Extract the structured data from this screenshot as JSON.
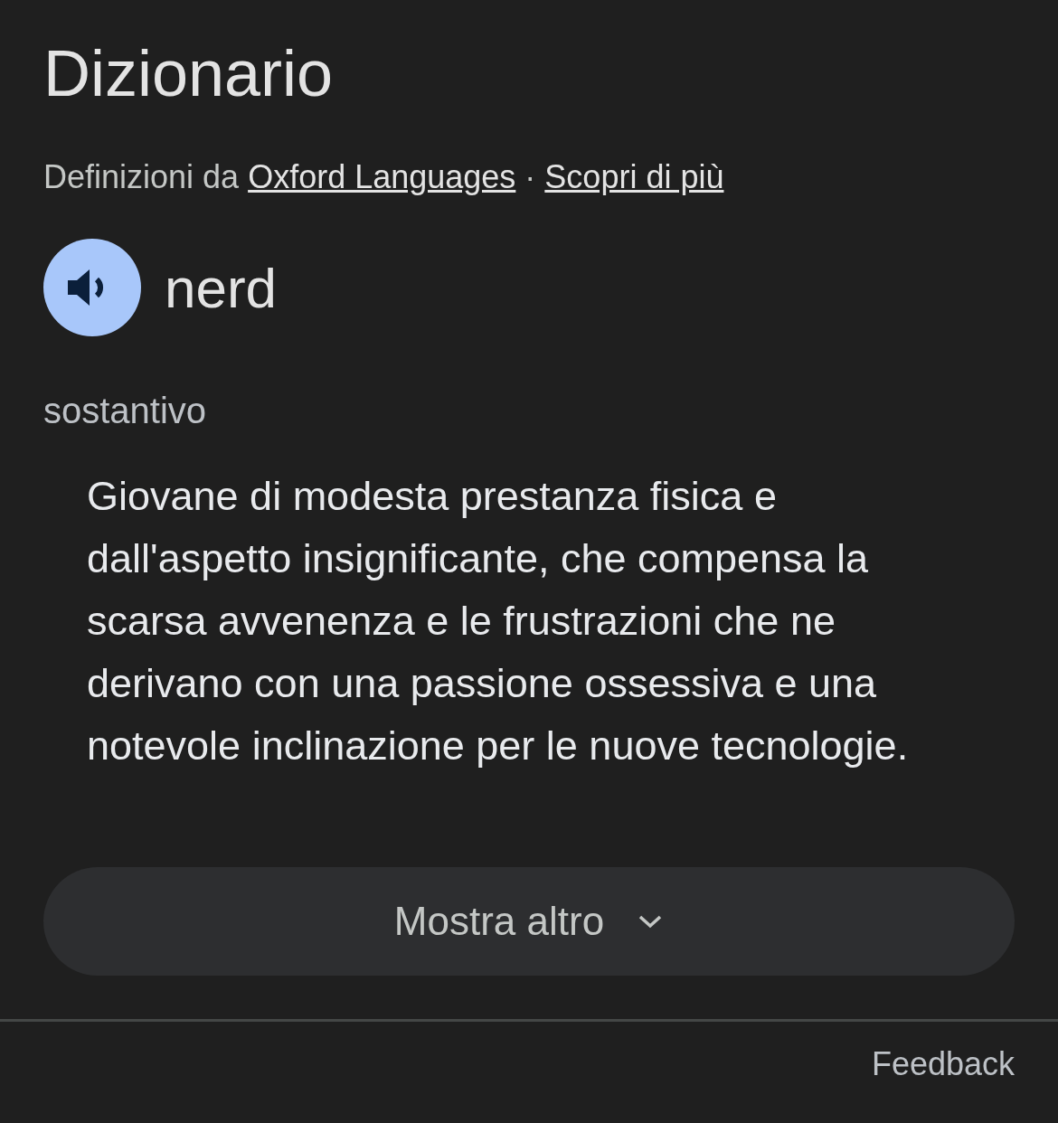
{
  "title": "Dizionario",
  "attribution": {
    "prefix": "Definizioni da",
    "source_link": "Oxford Languages",
    "separator": "·",
    "more_link": "Scopri di più"
  },
  "entry": {
    "word": "nerd",
    "part_of_speech": "sostantivo",
    "definition": "Giovane di modesta prestanza fisica e dall'aspetto insignificante, che compensa la scarsa avvenenza e le frustrazioni che ne derivano con una passione ossessiva e una notevole inclinazione per le nuove tecnologie."
  },
  "show_more_button": {
    "label": "Mostra altro"
  },
  "feedback_link": "Feedback"
}
